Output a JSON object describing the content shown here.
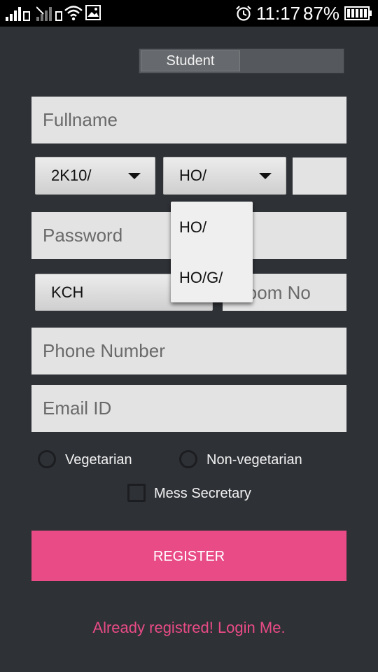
{
  "status_bar": {
    "time": "11:17",
    "battery_percent": "87%",
    "icons": [
      "signal-icon",
      "signal-icon-2",
      "wifi-icon",
      "image-icon",
      "alarm-icon",
      "battery-icon"
    ]
  },
  "segment": {
    "active_label": "Student"
  },
  "form": {
    "fullname_placeholder": "Fullname",
    "year_value": "2K10/",
    "branch_value": "HO/",
    "password_placeholder": "Password",
    "hostel_value": "KCH",
    "room_placeholder": "Room No",
    "phone_placeholder": "Phone Number",
    "email_placeholder": "Email ID"
  },
  "dropdown": {
    "options": [
      "HO/",
      "HO/G/"
    ]
  },
  "diet": {
    "veg_label": "Vegetarian",
    "nonveg_label": "Non-vegetarian"
  },
  "mess_label": "Mess Secretary",
  "register_label": "REGISTER",
  "login_link": "Already registred! Login Me.",
  "colors": {
    "accent": "#e94b87",
    "background": "#2e3136",
    "field": "#e3e3e3"
  }
}
